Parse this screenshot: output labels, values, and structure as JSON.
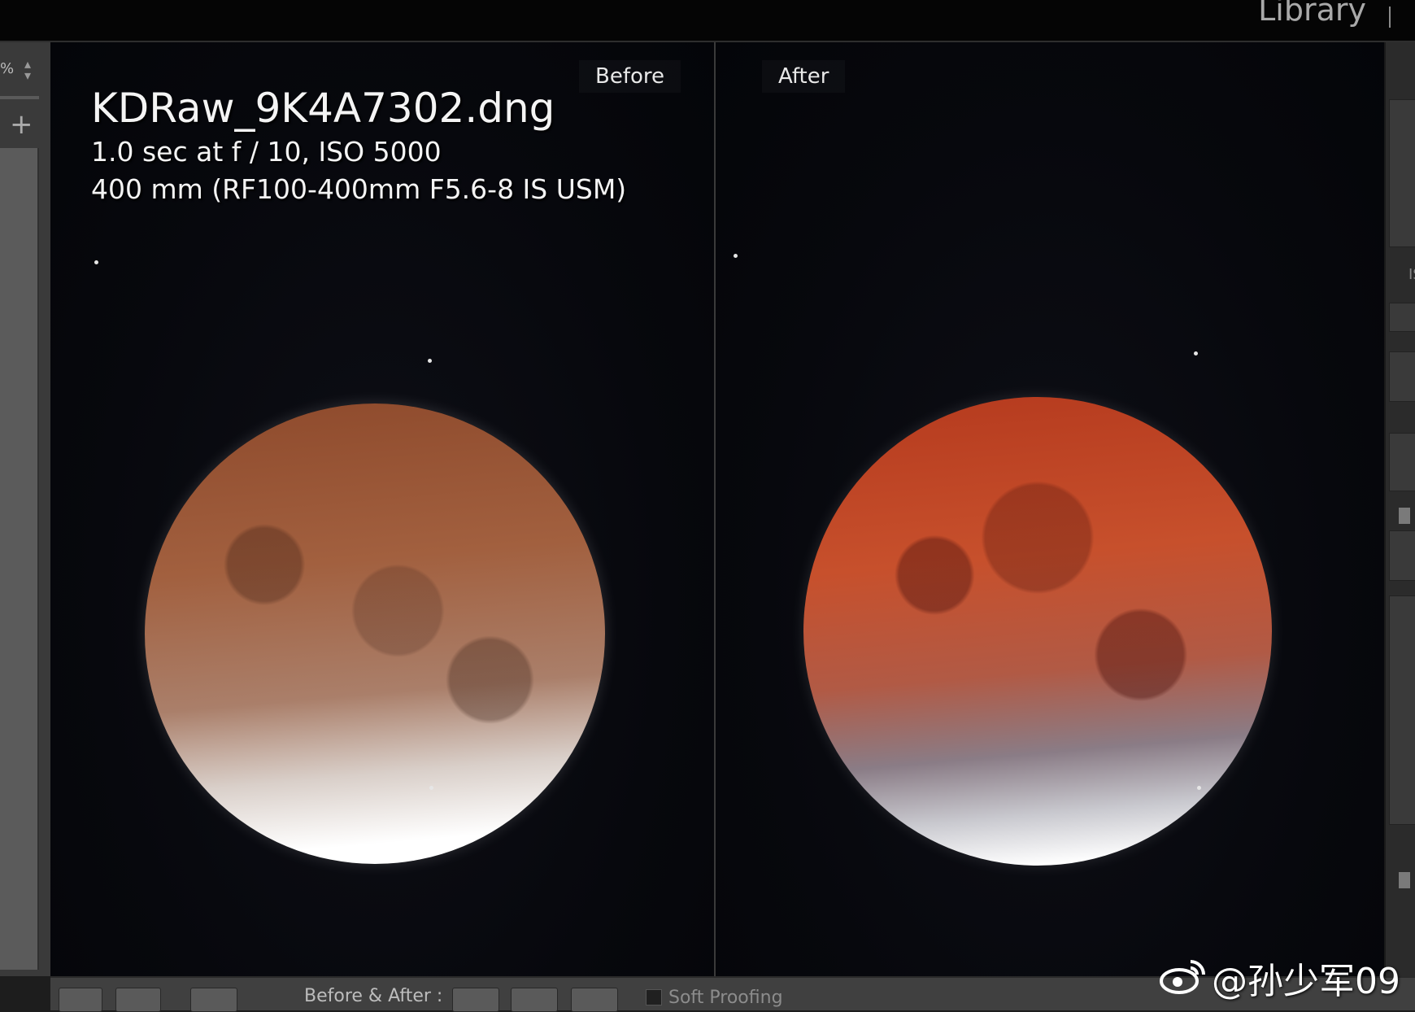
{
  "header": {
    "module": "Library"
  },
  "left_panel": {
    "zoom_suffix": "%",
    "add_icon": "plus-icon"
  },
  "viewer": {
    "before_label": "Before",
    "after_label": "After",
    "info": {
      "filename": "KDRaw_9K4A7302.dng",
      "exposure": "1.0 sec at f / 10, ISO 5000",
      "lens": "400 mm (RF100-400mm F5.6-8 IS USM)"
    }
  },
  "toolbar": {
    "before_after_label": "Before & After :",
    "soft_proofing_label": "Soft Proofing"
  },
  "right_panel": {
    "partial_label": "IS"
  },
  "watermark": {
    "text": "@孙少军09",
    "icon": "weibo-icon"
  },
  "colors": {
    "background": "#06070c",
    "panel": "#3a3a3a",
    "topbar": "#050505"
  }
}
